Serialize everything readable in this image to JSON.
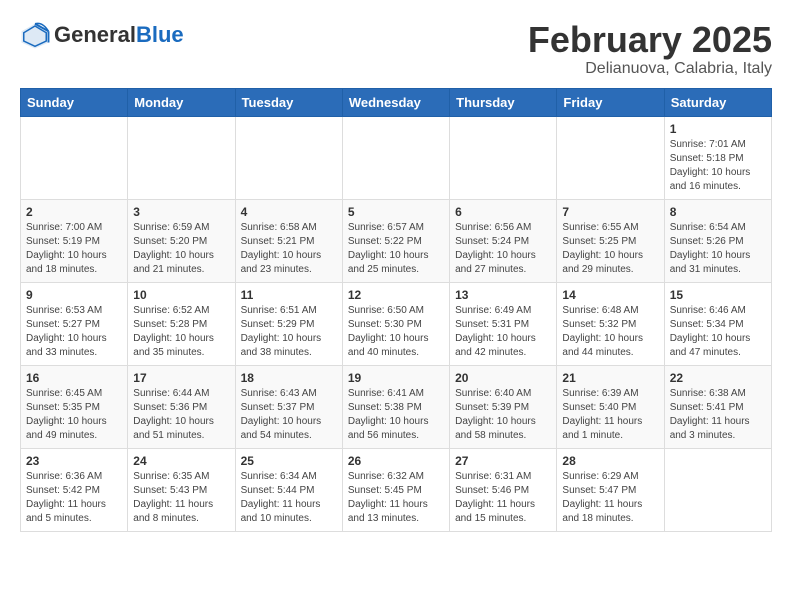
{
  "header": {
    "logo_general": "General",
    "logo_blue": "Blue",
    "month_year": "February 2025",
    "location": "Delianuova, Calabria, Italy"
  },
  "days_of_week": [
    "Sunday",
    "Monday",
    "Tuesday",
    "Wednesday",
    "Thursday",
    "Friday",
    "Saturday"
  ],
  "weeks": [
    [
      {
        "day": "",
        "info": ""
      },
      {
        "day": "",
        "info": ""
      },
      {
        "day": "",
        "info": ""
      },
      {
        "day": "",
        "info": ""
      },
      {
        "day": "",
        "info": ""
      },
      {
        "day": "",
        "info": ""
      },
      {
        "day": "1",
        "info": "Sunrise: 7:01 AM\nSunset: 5:18 PM\nDaylight: 10 hours\nand 16 minutes."
      }
    ],
    [
      {
        "day": "2",
        "info": "Sunrise: 7:00 AM\nSunset: 5:19 PM\nDaylight: 10 hours\nand 18 minutes."
      },
      {
        "day": "3",
        "info": "Sunrise: 6:59 AM\nSunset: 5:20 PM\nDaylight: 10 hours\nand 21 minutes."
      },
      {
        "day": "4",
        "info": "Sunrise: 6:58 AM\nSunset: 5:21 PM\nDaylight: 10 hours\nand 23 minutes."
      },
      {
        "day": "5",
        "info": "Sunrise: 6:57 AM\nSunset: 5:22 PM\nDaylight: 10 hours\nand 25 minutes."
      },
      {
        "day": "6",
        "info": "Sunrise: 6:56 AM\nSunset: 5:24 PM\nDaylight: 10 hours\nand 27 minutes."
      },
      {
        "day": "7",
        "info": "Sunrise: 6:55 AM\nSunset: 5:25 PM\nDaylight: 10 hours\nand 29 minutes."
      },
      {
        "day": "8",
        "info": "Sunrise: 6:54 AM\nSunset: 5:26 PM\nDaylight: 10 hours\nand 31 minutes."
      }
    ],
    [
      {
        "day": "9",
        "info": "Sunrise: 6:53 AM\nSunset: 5:27 PM\nDaylight: 10 hours\nand 33 minutes."
      },
      {
        "day": "10",
        "info": "Sunrise: 6:52 AM\nSunset: 5:28 PM\nDaylight: 10 hours\nand 35 minutes."
      },
      {
        "day": "11",
        "info": "Sunrise: 6:51 AM\nSunset: 5:29 PM\nDaylight: 10 hours\nand 38 minutes."
      },
      {
        "day": "12",
        "info": "Sunrise: 6:50 AM\nSunset: 5:30 PM\nDaylight: 10 hours\nand 40 minutes."
      },
      {
        "day": "13",
        "info": "Sunrise: 6:49 AM\nSunset: 5:31 PM\nDaylight: 10 hours\nand 42 minutes."
      },
      {
        "day": "14",
        "info": "Sunrise: 6:48 AM\nSunset: 5:32 PM\nDaylight: 10 hours\nand 44 minutes."
      },
      {
        "day": "15",
        "info": "Sunrise: 6:46 AM\nSunset: 5:34 PM\nDaylight: 10 hours\nand 47 minutes."
      }
    ],
    [
      {
        "day": "16",
        "info": "Sunrise: 6:45 AM\nSunset: 5:35 PM\nDaylight: 10 hours\nand 49 minutes."
      },
      {
        "day": "17",
        "info": "Sunrise: 6:44 AM\nSunset: 5:36 PM\nDaylight: 10 hours\nand 51 minutes."
      },
      {
        "day": "18",
        "info": "Sunrise: 6:43 AM\nSunset: 5:37 PM\nDaylight: 10 hours\nand 54 minutes."
      },
      {
        "day": "19",
        "info": "Sunrise: 6:41 AM\nSunset: 5:38 PM\nDaylight: 10 hours\nand 56 minutes."
      },
      {
        "day": "20",
        "info": "Sunrise: 6:40 AM\nSunset: 5:39 PM\nDaylight: 10 hours\nand 58 minutes."
      },
      {
        "day": "21",
        "info": "Sunrise: 6:39 AM\nSunset: 5:40 PM\nDaylight: 11 hours\nand 1 minute."
      },
      {
        "day": "22",
        "info": "Sunrise: 6:38 AM\nSunset: 5:41 PM\nDaylight: 11 hours\nand 3 minutes."
      }
    ],
    [
      {
        "day": "23",
        "info": "Sunrise: 6:36 AM\nSunset: 5:42 PM\nDaylight: 11 hours\nand 5 minutes."
      },
      {
        "day": "24",
        "info": "Sunrise: 6:35 AM\nSunset: 5:43 PM\nDaylight: 11 hours\nand 8 minutes."
      },
      {
        "day": "25",
        "info": "Sunrise: 6:34 AM\nSunset: 5:44 PM\nDaylight: 11 hours\nand 10 minutes."
      },
      {
        "day": "26",
        "info": "Sunrise: 6:32 AM\nSunset: 5:45 PM\nDaylight: 11 hours\nand 13 minutes."
      },
      {
        "day": "27",
        "info": "Sunrise: 6:31 AM\nSunset: 5:46 PM\nDaylight: 11 hours\nand 15 minutes."
      },
      {
        "day": "28",
        "info": "Sunrise: 6:29 AM\nSunset: 5:47 PM\nDaylight: 11 hours\nand 18 minutes."
      },
      {
        "day": "",
        "info": ""
      }
    ]
  ]
}
